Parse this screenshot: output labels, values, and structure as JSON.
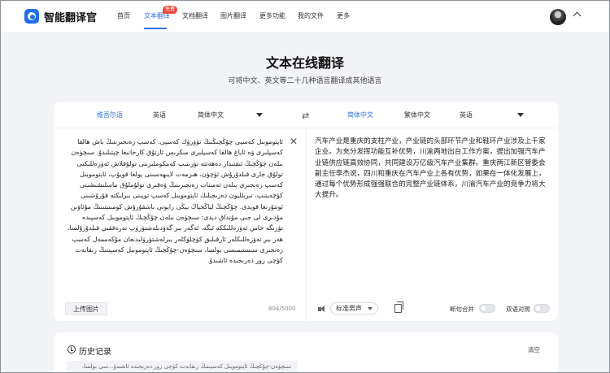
{
  "app": {
    "brand": "智能翻译官"
  },
  "nav": {
    "items": [
      {
        "label": "首页"
      },
      {
        "label": "文本翻译"
      },
      {
        "label": "文档翻译"
      },
      {
        "label": "图片翻译"
      },
      {
        "label": "更多功能"
      },
      {
        "label": "我的文件"
      },
      {
        "label": "更多"
      }
    ],
    "active_index": 1,
    "badge": "免费"
  },
  "page": {
    "title": "文本在线翻译",
    "subtitle": "可将中文、英文等二十几种语言翻译成其他语言"
  },
  "langbar": {
    "source": {
      "detected": "维吾尔语",
      "options": [
        "英语",
        "简体中文"
      ]
    },
    "target": {
      "options": [
        "简体中文",
        "繁体中文",
        "英语"
      ],
      "selected": "简体中文"
    }
  },
  "source_panel": {
    "text": "ئاپتوموبىل كەسپى چۇڭچىڭنىڭ تۈۋرۈك كەسپى. كەسپ زەنجىرىنىڭ باش ھالقا كەسپلىرى ۋە ئاياغ ھالقا كەسپلىرى مىكرىس ئارتۇق كارخانىغا چېتىلىدۇ. سىچۈەن بىلەن چۇڭچىڭ ئىقتىدار دەھەتتە تۈزىتىپ كەمكوملىرىنى تولۇقلاش ئەۋزەللىكنى تولۇق جارى قىلدۇرۇش ئۈچۈن، ھىرمەت لايىھەسىنى يولغا قويۇپ، ئاپتوموبىل كەسپ زەنجىرى بىلەن تەمىنات زەنجىرىنىڭ ۋەقىرى تولۇملۇق ماسلىشىشىنى كۈچەيتىپ، تىرىلليون دەرىجىلىك ئاپتوموبىل كەسپ توپىنى بىرلىكتە قۇرۇشىنى ئوتتۇرىغا قويدى. چۇڭچىڭ لياڭجياڭ يېڭى رايونى باشقۇرۇش كومىتېتىنىڭ مۇئاۋىن مۇدىرى لى جىې مۇنداق دېدى: سىچۈەن بىلەن چۇڭچىڭ ئاپتوموبىل كەسپىدە تۈزىگە خاس ئەۋزەللىككە ئىگە، ئەگەر بىر گەۋدىلەشتۈرۈپ تەرەققىي قىلدۇرۇلسا، ھەر بىر تەۋزەللىكلەر ئارقىلىق كۈچلۈكلەر بىرلەشتۈرۈلىدىغان مۇكەممەل كەسپ زەنجىرى سىستېمىسى بولسا، سىچۈەن-چۇڭچىڭ ئاپتوموبىل كەسپىنىڭ رىقابەت كۈچى زور دەرىجىدە ئاشىدۇ.",
    "upload_label": "上传图片",
    "char_count": "804/5000"
  },
  "target_panel": {
    "text": "汽车产业是重庆的支柱产业，产业链的头部环节产业和鞋环产业涉及上千家企业。为充分发挥功能互补优势，川渝两地出台工作方案，提出加强汽车产业链供应链高效协同，共同建设万亿级汽车产业集群。重庆两江新区管委会副主任李杰说，四川和重庆在汽车产业上各有优势，如果在一体化发展上，通过每个优势形成强强联合的完整产业链体系，川渝汽车产业的竞争力将大大提升。",
    "voice_label": "标准男声",
    "toggle_paragraph": "断句合并",
    "toggle_compare": "双语对照"
  },
  "history": {
    "title": "历史记录",
    "clear_label": "清空",
    "items": [
      {
        "text": "سىچۈەن-چۇڭچىڭ ئاپتوموبىل كەسپىنىڭ رىقابەت كۈچى زور دەرىجىدە ئاشىدۇ...سى بولسا،"
      }
    ]
  },
  "colors": {
    "accent": "#2d72e8",
    "badge": "#f04a3e",
    "page_bg": "#f3f4f7"
  }
}
